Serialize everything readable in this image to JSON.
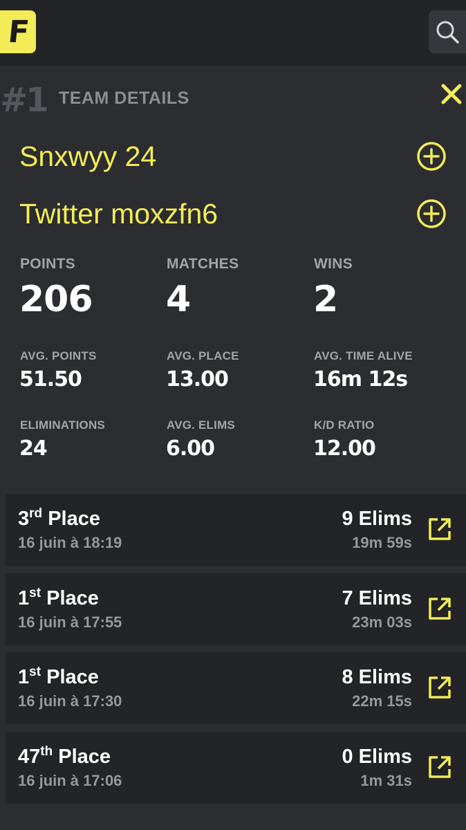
{
  "app": {
    "logo_letter": "F"
  },
  "header": {
    "rank": "#1",
    "title": "TEAM DETAILS"
  },
  "members": [
    {
      "name": "Snxwyy 24"
    },
    {
      "name": "Twitter moxzfn6"
    }
  ],
  "stats_main": [
    {
      "label": "POINTS",
      "value": "206"
    },
    {
      "label": "MATCHES",
      "value": "4"
    },
    {
      "label": "WINS",
      "value": "2"
    }
  ],
  "stats_secondary": [
    {
      "label": "AVG. POINTS",
      "value": "51.50"
    },
    {
      "label": "AVG. PLACE",
      "value": "13.00"
    },
    {
      "label": "AVG. TIME ALIVE",
      "value": "16m 12s"
    },
    {
      "label": "ELIMINATIONS",
      "value": "24"
    },
    {
      "label": "AVG. ELIMS",
      "value": "6.00"
    },
    {
      "label": "K/D RATIO",
      "value": "12.00"
    }
  ],
  "matches": [
    {
      "place_num": "3",
      "place_suffix": "rd",
      "place_word": "Place",
      "date": "16 juin à 18:19",
      "elims": "9 Elims",
      "time": "19m 59s"
    },
    {
      "place_num": "1",
      "place_suffix": "st",
      "place_word": "Place",
      "date": "16 juin à 17:55",
      "elims": "7 Elims",
      "time": "23m 03s"
    },
    {
      "place_num": "1",
      "place_suffix": "st",
      "place_word": "Place",
      "date": "16 juin à 17:30",
      "elims": "8 Elims",
      "time": "22m 15s"
    },
    {
      "place_num": "47",
      "place_suffix": "th",
      "place_word": "Place",
      "date": "16 juin à 17:06",
      "elims": "0 Elims",
      "time": "1m 31s"
    }
  ],
  "colors": {
    "accent": "#f3ec56",
    "background": "#2b2d31",
    "card": "#232427",
    "muted": "#a3a5aa"
  },
  "icons": {
    "search": "search-icon",
    "close": "close-icon",
    "add": "plus-circle-icon",
    "open": "external-link-icon"
  }
}
